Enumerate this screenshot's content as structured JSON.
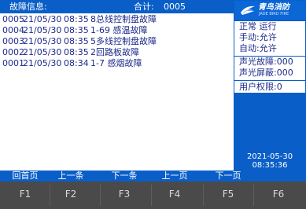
{
  "fault_list": {
    "title": "故障信息:",
    "total_label": "合计:",
    "total_value": "0005",
    "rows": [
      {
        "id": "0005",
        "date": "21/05/30",
        "time": "08:35",
        "addr": "",
        "desc": "8总线控制盘故障"
      },
      {
        "id": "0004",
        "date": "21/05/30",
        "time": "08:35",
        "addr": "",
        "desc": "1-69  感温故障"
      },
      {
        "id": "0003",
        "date": "21/05/30",
        "time": "08:35",
        "addr": "",
        "desc": "5多线控制盘故障"
      },
      {
        "id": "0002",
        "date": "21/05/30",
        "time": "08:35",
        "addr": "",
        "desc": "2回路板故障"
      },
      {
        "id": "0001",
        "date": "21/05/30",
        "time": "08:34",
        "addr": "",
        "desc": "1-7  感烟故障"
      }
    ]
  },
  "logo": {
    "text": "青鸟消防",
    "subtext": "JADE BIRD FIRE"
  },
  "status": {
    "state": "正常  运行",
    "manual": "手动:允许",
    "auto": "自动:允许",
    "alarm_fault": "声光故障:000",
    "alarm_mask": "声光屏蔽:000",
    "user_level": "用户权限:0"
  },
  "datetime": {
    "date": "2021-05-30",
    "time": "08:35:36"
  },
  "softkeys": [
    "回首页",
    "上一条",
    "下一条",
    "上一页",
    "下一页",
    ""
  ],
  "fkeys": [
    "F1",
    "F2",
    "F3",
    "F4",
    "F5",
    "F6"
  ],
  "colors": {
    "screen_blue": "#0a5ec8",
    "text_navy": "#1e2a8a",
    "panel_bg": "#4a4a4a"
  }
}
